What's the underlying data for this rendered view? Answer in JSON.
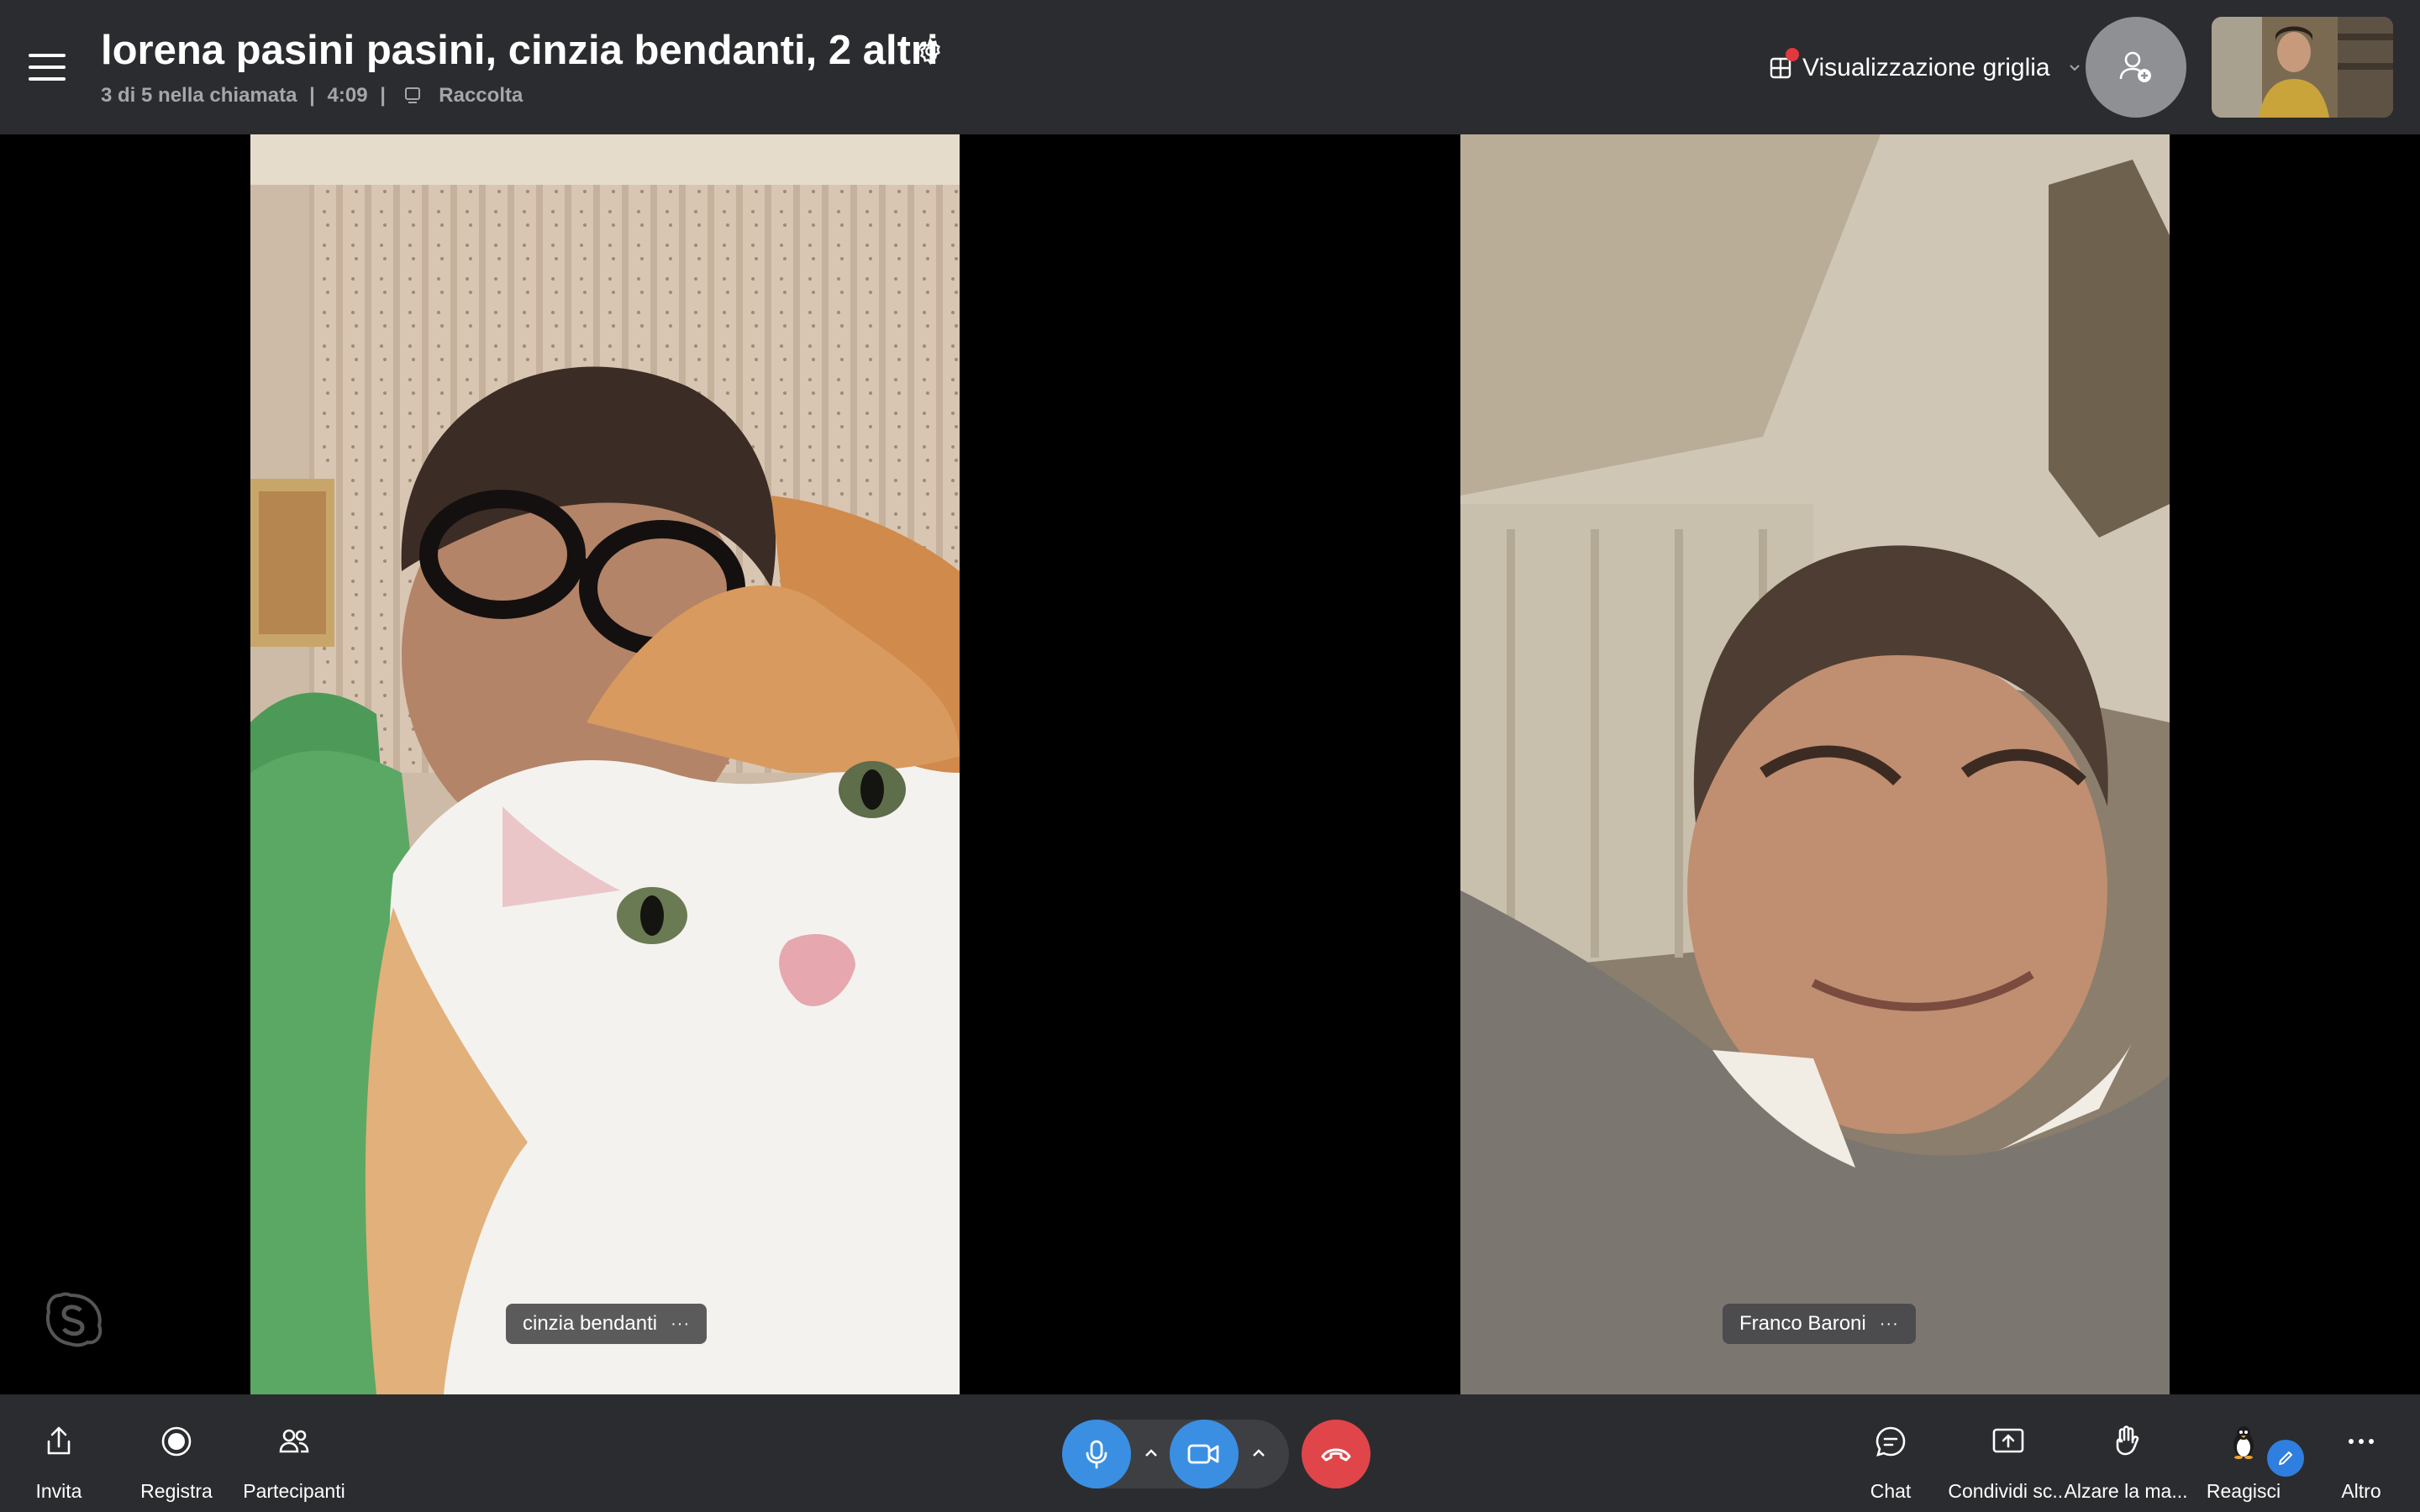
{
  "header": {
    "title": "lorena pasini pasini, cinzia bendanti, 2 altri",
    "participants_info": "3 di 5 nella chiamata",
    "separator": "|",
    "call_duration": "4:09",
    "gallery_label": "Raccolta",
    "view_mode_label": "Visualizzazione griglia"
  },
  "tiles": [
    {
      "name": "cinzia bendanti",
      "more": "···"
    },
    {
      "name": "Franco Baroni",
      "more": "···"
    }
  ],
  "toolbar": {
    "left": [
      {
        "label": "Invita",
        "icon": "share-icon"
      },
      {
        "label": "Registra",
        "icon": "record-icon"
      },
      {
        "label": "Partecipanti",
        "icon": "participants-icon"
      }
    ],
    "right": [
      {
        "label": "Chat",
        "icon": "chat-icon"
      },
      {
        "label": "Condividi sc...",
        "icon": "share-screen-icon"
      },
      {
        "label": "Alzare la ma...",
        "icon": "raise-hand-icon"
      },
      {
        "label": "Reagisci",
        "icon": "penguin-icon"
      },
      {
        "label": "Altro",
        "icon": "more-icon"
      }
    ]
  },
  "colors": {
    "bar_background": "#2b2c2f",
    "accent_blue": "#3a8fe3",
    "hangup_red": "#e0454a",
    "notification_dot": "#e0393e"
  }
}
